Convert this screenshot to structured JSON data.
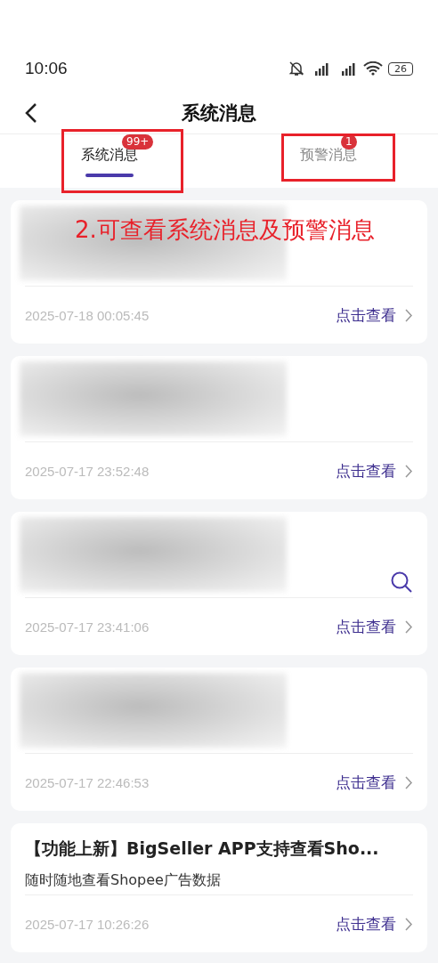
{
  "status_bar": {
    "time": "10:06",
    "battery": "26"
  },
  "header": {
    "title": "系统消息"
  },
  "tabs": [
    {
      "label": "系统消息",
      "badge": "99+",
      "selected": true,
      "highlighted": true
    },
    {
      "label": "预警消息",
      "badge": "1",
      "selected": false,
      "highlighted": true
    }
  ],
  "annotation": {
    "text": "2.可查看系统消息及预警消息"
  },
  "messages": [
    {
      "kind": "blurred",
      "search_icon": false,
      "time": "2025-07-18 00:05:45",
      "action": "点击查看"
    },
    {
      "kind": "blurred",
      "search_icon": false,
      "time": "2025-07-17 23:52:48",
      "action": "点击查看"
    },
    {
      "kind": "blurred",
      "search_icon": true,
      "time": "2025-07-17 23:41:06",
      "action": "点击查看"
    },
    {
      "kind": "blurred",
      "search_icon": false,
      "time": "2025-07-17 22:46:53",
      "action": "点击查看"
    },
    {
      "kind": "text",
      "search_icon": false,
      "title": "【功能上新】BigSeller APP支持查看Sho...",
      "body": "随时随地查看Shopee广告数据",
      "time": "2025-07-17 10:26:26",
      "action": "点击查看"
    }
  ]
}
